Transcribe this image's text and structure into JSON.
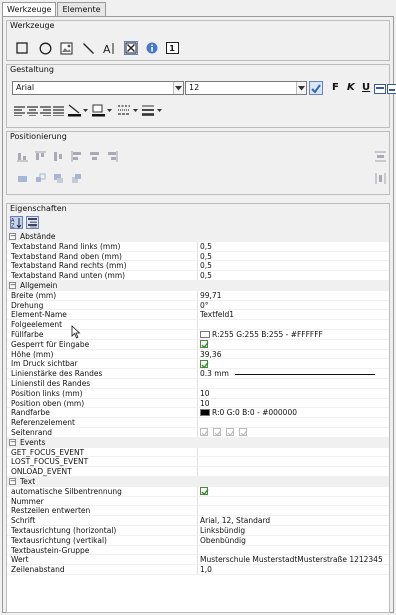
{
  "tabs": [
    "Werkzeuge",
    "Elemente"
  ],
  "toolbox": {
    "title": "Werkzeuge",
    "icons": [
      "rectangle-icon",
      "ellipse-icon",
      "image-icon",
      "line-icon",
      "text-icon",
      "checkbox-icon",
      "info-icon",
      "page-number-icon"
    ],
    "page_number_glyph": "1"
  },
  "design": {
    "title": "Gestaltung",
    "font_family": "Arial",
    "font_size": "12",
    "bold": "F",
    "italic": "K",
    "underline": "U"
  },
  "positioning": {
    "title": "Positionierung"
  },
  "properties": {
    "title": "Eigenschaften",
    "sections": [
      {
        "name": "Abstände",
        "rows": [
          {
            "name": "Textabstand Rand links (mm)",
            "value": "0,5"
          },
          {
            "name": "Textabstand Rand oben (mm)",
            "value": "0,5"
          },
          {
            "name": "Textabstand Rand rechts (mm)",
            "value": "0,5"
          },
          {
            "name": "Textabstand Rand unten (mm)",
            "value": "0,5"
          }
        ]
      },
      {
        "name": "Allgemein",
        "rows": [
          {
            "name": "Breite (mm)",
            "value": "99,71"
          },
          {
            "name": "Drehung",
            "value": "0°"
          },
          {
            "name": "Element-Name",
            "value": "Textfeld1"
          },
          {
            "name": "Folgeelement",
            "value": ""
          },
          {
            "name": "Füllfarbe",
            "value": "R:255 G:255 B:255 - #FFFFFF",
            "type": "color",
            "color": "#FFFFFF"
          },
          {
            "name": "Gesperrt für Eingabe",
            "value": "",
            "type": "check"
          },
          {
            "name": "Höhe (mm)",
            "value": "39,36"
          },
          {
            "name": "Im Druck sichtbar",
            "value": "",
            "type": "check"
          },
          {
            "name": "Linienstärke des Randes",
            "value": "0.3 mm",
            "type": "line"
          },
          {
            "name": "Linienstil des Randes",
            "value": ""
          },
          {
            "name": "Position links (mm)",
            "value": "10"
          },
          {
            "name": "Position oben (mm)",
            "value": "10"
          },
          {
            "name": "Randfarbe",
            "value": "R:0 G:0 B:0 - #000000",
            "type": "color",
            "color": "#000000"
          },
          {
            "name": "Referenzelement",
            "value": ""
          },
          {
            "name": "Seitenrand",
            "value": "",
            "type": "checks4"
          }
        ]
      },
      {
        "name": "Events",
        "rows": [
          {
            "name": "GET_FOCUS_EVENT",
            "value": ""
          },
          {
            "name": "LOST_FOCUS_EVENT",
            "value": ""
          },
          {
            "name": "ONLOAD_EVENT",
            "value": ""
          }
        ]
      },
      {
        "name": "Text",
        "rows": [
          {
            "name": "automatische Silbentrennung",
            "value": "",
            "type": "check"
          },
          {
            "name": "Nummer",
            "value": ""
          },
          {
            "name": "Restzeilen entwerten",
            "value": ""
          },
          {
            "name": "Schrift",
            "value": "Arial, 12, Standard"
          },
          {
            "name": "Textausrichtung (horizontal)",
            "value": "Linksbündig"
          },
          {
            "name": "Textausrichtung (vertikal)",
            "value": "Obenbündig"
          },
          {
            "name": "Textbaustein-Gruppe",
            "value": ""
          },
          {
            "name": "Wert",
            "value": "Musterschule MusterstadtMusterstraße 1212345 Musterstadt"
          },
          {
            "name": "Zeilenabstand",
            "value": "1,0"
          }
        ]
      }
    ]
  },
  "colors": {
    "check": "#2e8b2e",
    "group_border": "#bdbdbd",
    "accent": "#3c5a9a"
  }
}
